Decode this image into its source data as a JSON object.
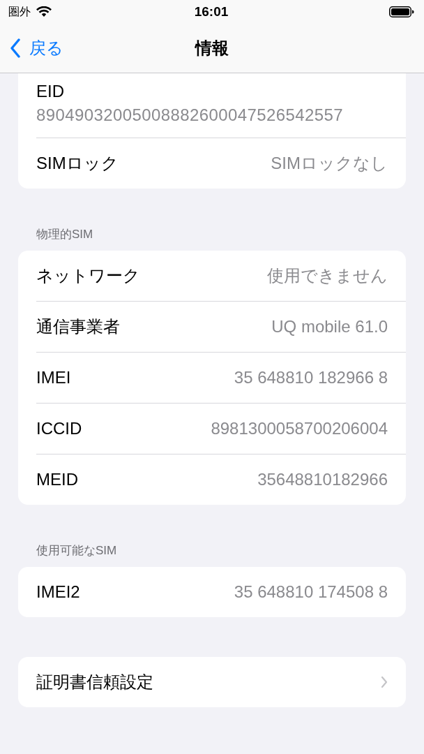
{
  "status_bar": {
    "carrier": "圏外",
    "time": "16:01"
  },
  "nav": {
    "back": "戻る",
    "title": "情報"
  },
  "sections": [
    {
      "cut_top": true,
      "rows": [
        {
          "kind": "stacked",
          "label": "EID",
          "value": "89049032005008882600047526542557"
        },
        {
          "kind": "value",
          "label": "SIMロック",
          "value": "SIMロックなし"
        }
      ]
    },
    {
      "header": "物理的SIM",
      "rows": [
        {
          "kind": "value",
          "label": "ネットワーク",
          "value": "使用できません"
        },
        {
          "kind": "value",
          "label": "通信事業者",
          "value": "UQ mobile 61.0"
        },
        {
          "kind": "value",
          "label": "IMEI",
          "value": "35 648810 182966 8"
        },
        {
          "kind": "value",
          "label": "ICCID",
          "value": "8981300058700206004"
        },
        {
          "kind": "value",
          "label": "MEID",
          "value": "35648810182966"
        }
      ]
    },
    {
      "header": "使用可能なSIM",
      "rows": [
        {
          "kind": "value",
          "label": "IMEI2",
          "value": "35 648810 174508 8"
        }
      ]
    },
    {
      "gap": true,
      "rows": [
        {
          "kind": "link",
          "label": "証明書信頼設定"
        }
      ]
    }
  ]
}
